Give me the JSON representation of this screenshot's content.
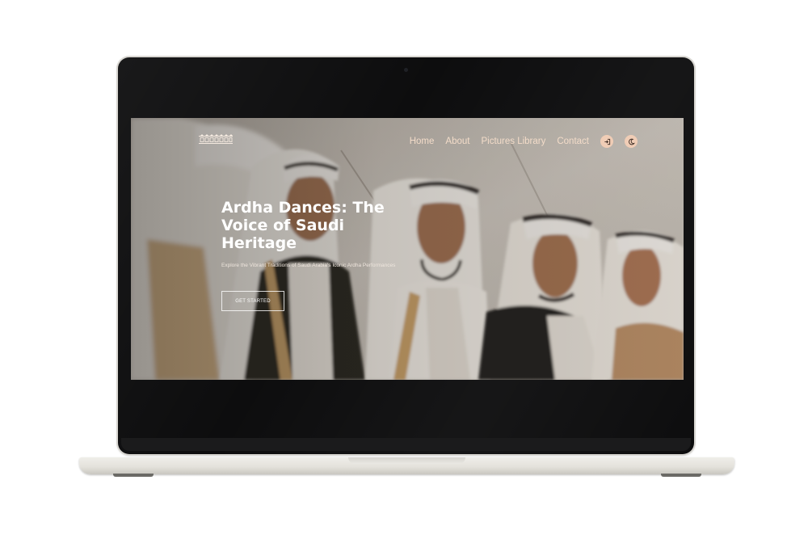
{
  "site": {
    "logo_alt": "Ardha logo",
    "nav": {
      "items": [
        {
          "label": "Home"
        },
        {
          "label": "About"
        },
        {
          "label": "Pictures Library"
        },
        {
          "label": "Contact"
        }
      ],
      "login_icon": "login-icon",
      "theme_icon": "moon-icon"
    },
    "hero": {
      "title": "Ardha Dances: The Voice of Saudi Heritage",
      "subtitle": "Explore the Vibrant Traditions of Saudi Arabia's Iconic Ardha Performances",
      "cta": "GET STARTED"
    }
  },
  "colors": {
    "nav_text": "#f3dcc9",
    "icon_button_bg": "#f0cdb6",
    "laptop_body": "#e4e2dc",
    "bezel": "#0d0d0e"
  }
}
